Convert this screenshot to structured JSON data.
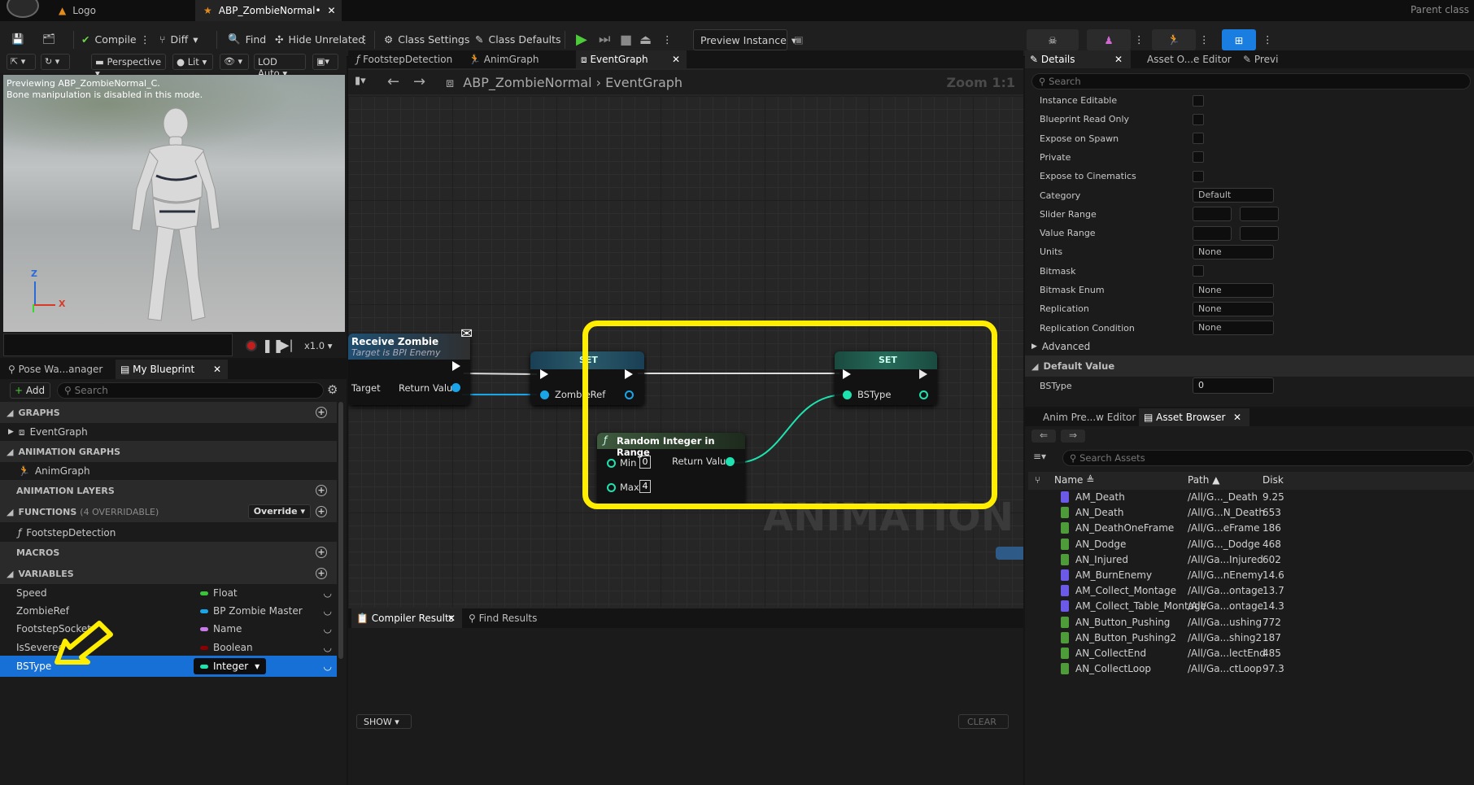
{
  "titlebar": {
    "tabs": [
      {
        "label": "Logo"
      },
      {
        "label": "ABP_ZombieNormal•"
      }
    ],
    "right_text": "Parent class"
  },
  "toolbar": {
    "compile": "Compile",
    "diff": "Diff",
    "find": "Find",
    "hide_unrelated": "Hide Unrelated",
    "class_settings": "Class Settings",
    "class_defaults": "Class Defaults",
    "preview_instance": "Preview Instance"
  },
  "viewport": {
    "perspective": "Perspective",
    "lit": "Lit",
    "lod": "LOD Auto",
    "overlay_line1": "Previewing ABP_ZombieNormal_C.",
    "overlay_line2": "Bone manipulation is disabled in this mode.",
    "axis_z": "Z",
    "axis_x": "X",
    "speed": "x1.0"
  },
  "left_tabs": {
    "pose": "Pose Wa...anager",
    "myblueprint": "My Blueprint"
  },
  "myblueprint": {
    "add": "Add",
    "search_placeholder": "Search",
    "graphs_header": "GRAPHS",
    "graphs": [
      "EventGraph"
    ],
    "anim_graphs_header": "ANIMATION GRAPHS",
    "anim_graphs": [
      "AnimGraph"
    ],
    "anim_layers_header": "ANIMATION LAYERS",
    "functions_header": "FUNCTIONS",
    "functions_count": "(4 OVERRIDABLE)",
    "override": "Override",
    "functions": [
      "FootstepDetection"
    ],
    "macros_header": "MACROS",
    "variables_header": "VARIABLES",
    "variables": [
      {
        "name": "Speed",
        "type": "Float",
        "color": "#39c43a"
      },
      {
        "name": "ZombieRef",
        "type": "BP Zombie Master",
        "color": "#1aa5e8"
      },
      {
        "name": "FootstepSocket",
        "type": "Name",
        "color": "#c77ae8"
      },
      {
        "name": "IsSevered",
        "type": "Boolean",
        "color": "#8b0000"
      },
      {
        "name": "BSType",
        "type": "Integer",
        "color": "#1ee3b0"
      }
    ]
  },
  "graph": {
    "tabs": [
      "FootstepDetection",
      "AnimGraph",
      "EventGraph"
    ],
    "breadcrumb_root": "ABP_ZombieNormal",
    "breadcrumb_leaf": "EventGraph",
    "zoom": "Zoom 1:1",
    "watermark": "ANIMATION",
    "nodes": {
      "receive_title": "Receive Zombie",
      "receive_sub": "Target is BPI Enemy",
      "receive_target": "Target",
      "receive_return": "Return Value",
      "set1_title": "SET",
      "set1_pin": "ZombieRef",
      "set2_title": "SET",
      "set2_pin": "BSType",
      "rand_title": "Random Integer in Range",
      "rand_min": "Min",
      "rand_min_val": "0",
      "rand_max": "Max",
      "rand_max_val": "4",
      "rand_return": "Return Value"
    }
  },
  "bottom": {
    "compiler_tab": "Compiler Results",
    "find_tab": "Find Results",
    "show": "SHOW",
    "clear": "CLEAR"
  },
  "details": {
    "tab": "Details",
    "tab2": "Asset O...e Editor",
    "tab3": "Previ",
    "search_placeholder": "Search",
    "rows": [
      {
        "label": "Instance Editable",
        "kind": "check"
      },
      {
        "label": "Blueprint Read Only",
        "kind": "check"
      },
      {
        "label": "Expose on Spawn",
        "kind": "check"
      },
      {
        "label": "Private",
        "kind": "check"
      },
      {
        "label": "Expose to Cinematics",
        "kind": "check"
      },
      {
        "label": "Category",
        "kind": "dropdown",
        "value": "Default"
      },
      {
        "label": "Slider Range",
        "kind": "range"
      },
      {
        "label": "Value Range",
        "kind": "range"
      },
      {
        "label": "Units",
        "kind": "dropdown",
        "value": "None"
      },
      {
        "label": "Bitmask",
        "kind": "check"
      },
      {
        "label": "Bitmask Enum",
        "kind": "dropdown",
        "value": "None"
      },
      {
        "label": "Replication",
        "kind": "dropdown",
        "value": "None"
      },
      {
        "label": "Replication Condition",
        "kind": "dropdown",
        "value": "None"
      }
    ],
    "advanced": "Advanced",
    "default_value_header": "Default Value",
    "default_value_label": "BSType",
    "default_value": "0"
  },
  "assets": {
    "tab1": "Anim Pre...w Editor",
    "tab2": "Asset Browser",
    "search_placeholder": "Search Assets",
    "col_name": "Name",
    "col_path": "Path",
    "col_disk": "Disk",
    "rows": [
      {
        "name": "AM_Death",
        "path": "/All/G..._Death",
        "disk": "9.25",
        "type": "montage"
      },
      {
        "name": "AN_Death",
        "path": "/All/G...N_Death",
        "disk": "653",
        "type": "notify"
      },
      {
        "name": "AN_DeathOneFrame",
        "path": "/All/G...eFrame",
        "disk": "186",
        "type": "notify"
      },
      {
        "name": "AN_Dodge",
        "path": "/All/G..._Dodge",
        "disk": "468",
        "type": "notify"
      },
      {
        "name": "AN_Injured",
        "path": "/All/Ga...Injured",
        "disk": "602",
        "type": "notify"
      },
      {
        "name": "AM_BurnEnemy",
        "path": "/All/G...nEnemy",
        "disk": "14.6",
        "type": "montage"
      },
      {
        "name": "AM_Collect_Montage",
        "path": "/All/Ga...ontage",
        "disk": "13.7",
        "type": "montage"
      },
      {
        "name": "AM_Collect_Table_Montage",
        "path": "/All/Ga...ontage",
        "disk": "14.3",
        "type": "montage"
      },
      {
        "name": "AN_Button_Pushing",
        "path": "/All/Ga...ushing",
        "disk": "772",
        "type": "notify"
      },
      {
        "name": "AN_Button_Pushing2",
        "path": "/All/Ga...shing2",
        "disk": "187",
        "type": "notify"
      },
      {
        "name": "AN_CollectEnd",
        "path": "/All/Ga...lectEnd",
        "disk": "485",
        "type": "notify"
      },
      {
        "name": "AN_CollectLoop",
        "path": "/All/Ga...ctLoop",
        "disk": "97.3",
        "type": "notify"
      }
    ]
  }
}
